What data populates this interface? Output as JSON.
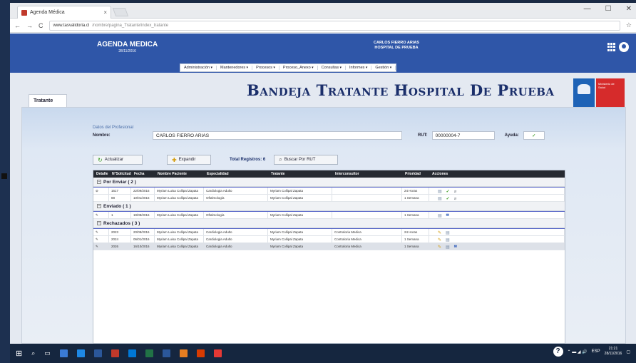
{
  "browser": {
    "tab_title": "Agenda Médica",
    "tab_close": "×",
    "url_host": "www.tasvalidoria.cl",
    "url_path": "/nombre/pagina_Tratante/index_tratante",
    "win_min": "—",
    "win_max": "☐",
    "win_close": "✕",
    "nav_back": "←",
    "nav_forward": "→",
    "nav_reload": "C",
    "star": "☆"
  },
  "header": {
    "app_name": "AGENDA MEDICA",
    "date": "28/11/2016",
    "user_name": "CARLOS FIERRO ARIAS",
    "hospital": "HOSPITAL DE PRUEBA",
    "menu": [
      "Administración",
      "Mantenedores",
      "Procesos",
      "Proceso_Anexo",
      "Consultas",
      "Informes",
      "Gestión"
    ]
  },
  "page": {
    "tab_label": "Tratante",
    "title": "Bandeja Tratante Hospital De Prueba",
    "logo2_text": "Ministerio de Salud"
  },
  "form": {
    "section_label": "Datos del Profesional",
    "name_label": "Nombre:",
    "name_value": "CARLOS FIERRO ARIAS",
    "rut_label": "RUT:",
    "rut_value": "00000004-7",
    "ayuda_label": "Ayuda:",
    "ayuda_icon": "✓"
  },
  "toolbar": {
    "refresh_label": "Actualizar",
    "expand_label": "Expandir",
    "total_label": "Total Registros: 6",
    "search_rut_label": "Buscar Por RUT"
  },
  "table": {
    "headers": [
      "Detalle",
      "N°Solicitud",
      "Fecha",
      "Nombre Paciente",
      "Especialidad",
      "Tratante",
      "Interconsultor",
      "Prioridad",
      "Acciones"
    ],
    "groups": [
      {
        "label": "Por Enviar ( 2 )",
        "toggle": "–",
        "rows": [
          {
            "detail": "⊘",
            "id": "1617",
            "date": "22/09/2016",
            "patient": "Myriam Luisa Collipal Zapata",
            "specialty": "Cardiologia Adulto",
            "treating": "Myriam Collipal Zapata",
            "consultant": "",
            "priority": "24 Horas",
            "actions": [
              "doc",
              "check",
              "clip"
            ]
          },
          {
            "detail": "",
            "id": "88",
            "date": "10/01/2016",
            "patient": "Myriam Luisa Collipal Zapata",
            "specialty": "Oftalmología",
            "treating": "Myriam Collipal Zapata",
            "consultant": "",
            "priority": "1 Semana",
            "actions": [
              "doc",
              "check",
              "clip"
            ]
          }
        ]
      },
      {
        "label": "Enviado ( 1 )",
        "toggle": "–",
        "rows": [
          {
            "detail": "✎",
            "id": "1",
            "date": "19/08/2016",
            "patient": "Myriam Luisa Collipal Zapata",
            "specialty": "Oftalmología",
            "treating": "Myriam Collipal Zapata",
            "consultant": "",
            "priority": "1 Semana",
            "actions": [
              "doc",
              "mail"
            ]
          }
        ]
      },
      {
        "label": "Rechazados ( 3 )",
        "toggle": "–",
        "rows": [
          {
            "detail": "✎",
            "id": "2023",
            "date": "20/09/2016",
            "patient": "Myriam Luisa Collipal Zapata",
            "specialty": "Cardiologia Adulto",
            "treating": "Myriam Collipal Zapata",
            "consultant": "Contraloria Medica",
            "priority": "24 Horas",
            "actions": [
              "pencil",
              "doc"
            ]
          },
          {
            "detail": "✎",
            "id": "2024",
            "date": "06/01/2016",
            "patient": "Myriam Luisa Collipal Zapata",
            "specialty": "Cardiologia Adulto",
            "treating": "Myriam Collipal Zapata",
            "consultant": "Contraloria Medica",
            "priority": "1 Semana",
            "actions": [
              "pencil",
              "doc"
            ]
          },
          {
            "detail": "✎",
            "id": "2026",
            "date": "16/10/2016",
            "patient": "Myriam Luisa Collipal Zapata",
            "specialty": "Cardiologia Adulto",
            "treating": "Myriam Collipal Zapata",
            "consultant": "Contraloria Medica",
            "priority": "1 Semana",
            "actions": [
              "pencil",
              "doc",
              "mail"
            ]
          }
        ]
      }
    ]
  },
  "action_glyphs": {
    "doc": "▤",
    "check": "✓",
    "clip": "⌀",
    "pencil": "✎",
    "mail": "✉"
  },
  "taskbar": {
    "help": "?",
    "tray_text": "ESP",
    "time": "21:21",
    "date": "28/11/2016",
    "colors": [
      "#3a7bd5",
      "#1e88e5",
      "#2b579a",
      "#c0392b",
      "#0078d7",
      "#217346",
      "#2b579a",
      "#e67e22",
      "#d83b01",
      "#e53935"
    ]
  }
}
